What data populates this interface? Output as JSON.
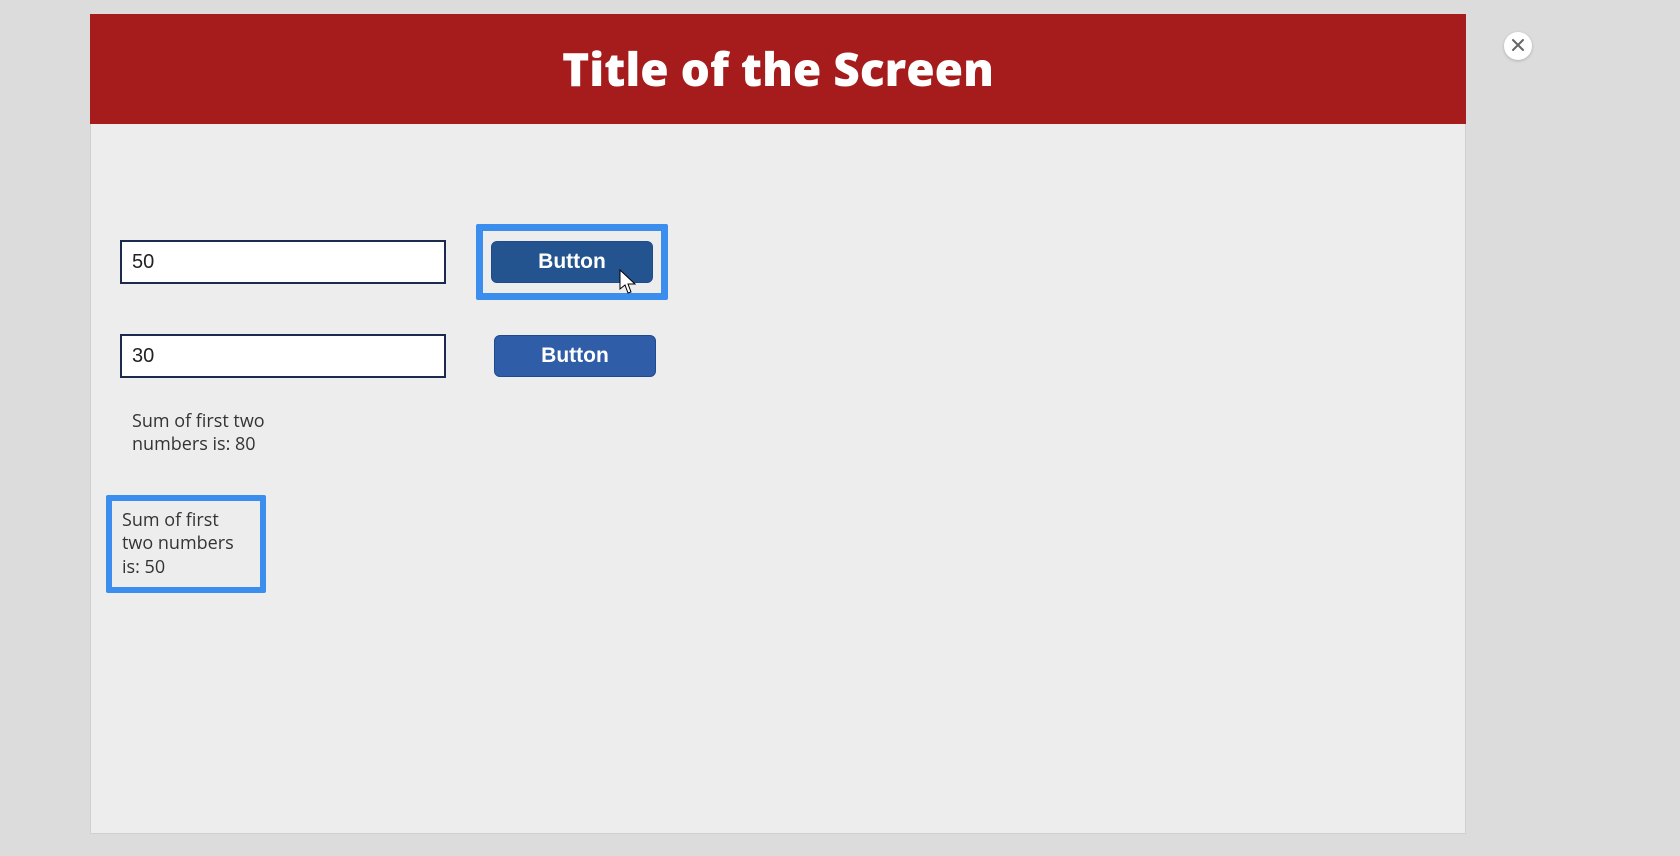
{
  "header": {
    "title": "Title of the Screen"
  },
  "inputs": {
    "first": {
      "value": "50"
    },
    "second": {
      "value": "30"
    }
  },
  "buttons": {
    "first": {
      "label": "Button"
    },
    "second": {
      "label": "Button"
    }
  },
  "results": {
    "line1": "Sum of first two numbers is: 80",
    "line2": "Sum of first two numbers is: 50"
  },
  "colors": {
    "header_bg": "#a61b1b",
    "button_bg": "#2f5da8",
    "highlight_border": "#3b8eed"
  }
}
